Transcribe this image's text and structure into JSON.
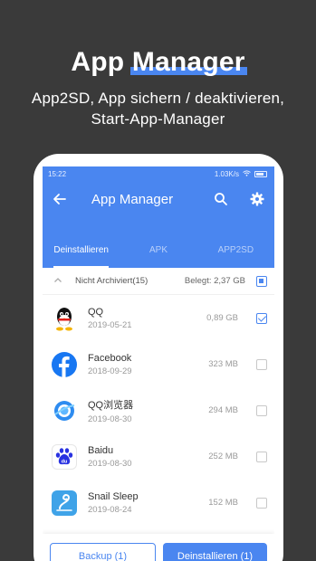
{
  "promo": {
    "title_part1": "App ",
    "title_part2": "Manager",
    "subtitle_line1": "App2SD, App sichern / deaktivieren,",
    "subtitle_line2": "Start-App-Manager"
  },
  "statusbar": {
    "time": "15:22",
    "net": "1.03K/s"
  },
  "toolbar": {
    "back_icon": "arrow-left-icon",
    "title": "App Manager",
    "search_icon": "search-icon",
    "settings_icon": "gear-icon"
  },
  "tabs": [
    {
      "label": "Deinstallieren",
      "active": true
    },
    {
      "label": "APK",
      "active": false
    },
    {
      "label": "APP2SD",
      "active": false
    }
  ],
  "group": {
    "label": "Nicht Archiviert(15)",
    "used": "Belegt: 2,37 GB"
  },
  "apps": [
    {
      "name": "QQ",
      "date": "2019-05-21",
      "size": "0,89 GB",
      "checked": true
    },
    {
      "name": "Facebook",
      "date": "2018-09-29",
      "size": "323 MB",
      "checked": false
    },
    {
      "name": "QQ浏览器",
      "date": "2019-08-30",
      "size": "294 MB",
      "checked": false
    },
    {
      "name": "Baidu",
      "date": "2019-08-30",
      "size": "252 MB",
      "checked": false
    },
    {
      "name": "Snail Sleep",
      "date": "2019-08-24",
      "size": "152 MB",
      "checked": false
    }
  ],
  "buttons": {
    "backup": "Backup (1)",
    "uninstall": "Deinstallieren (1)"
  },
  "colors": {
    "accent": "#4a86f0",
    "background": "#3a3a3a"
  }
}
